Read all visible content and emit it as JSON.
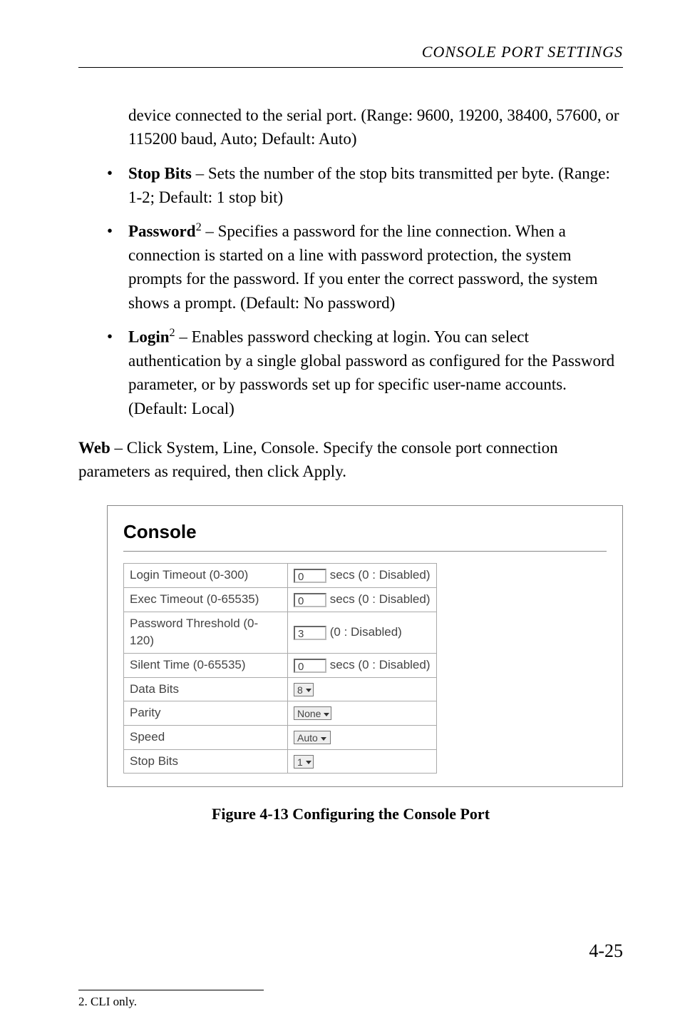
{
  "running_head": "CONSOLE PORT SETTINGS",
  "continuation_paragraph": "device connected to the serial port. (Range: 9600, 19200, 38400, 57600, or 115200 baud, Auto; Default: Auto)",
  "bullets": [
    {
      "term": "Stop Bits",
      "sup": "",
      "text": " – Sets the number of the stop bits transmitted per byte. (Range: 1-2; Default: 1 stop bit)"
    },
    {
      "term": "Password",
      "sup": "2",
      "text": " – Specifies a password for the line connection. When a connection is started on a line with password protection, the system prompts for the password. If you enter the correct password, the system shows a prompt. (Default: No password)"
    },
    {
      "term": "Login",
      "sup": "2",
      "text": " – Enables password checking at login. You can select authentication by a single global password as configured for the Password parameter, or by passwords set up for specific user-name accounts. (Default: Local)"
    }
  ],
  "web_para_lead": "Web",
  "web_para_text": " – Click System, Line, Console. Specify the console port connection parameters as required, then click Apply.",
  "figure": {
    "title": "Console",
    "rows": [
      {
        "label": "Login Timeout (0-300)",
        "value": "0",
        "suffix": "secs (0 : Disabled)",
        "type": "input"
      },
      {
        "label": "Exec Timeout (0-65535)",
        "value": "0",
        "suffix": "secs (0 : Disabled)",
        "type": "input"
      },
      {
        "label": "Password Threshold (0-120)",
        "value": "3",
        "suffix": "(0 : Disabled)",
        "type": "input"
      },
      {
        "label": "Silent Time (0-65535)",
        "value": "0",
        "suffix": "secs (0 : Disabled)",
        "type": "input"
      },
      {
        "label": "Data Bits",
        "value": "8",
        "suffix": "",
        "type": "select"
      },
      {
        "label": "Parity",
        "value": "None",
        "suffix": "",
        "type": "select"
      },
      {
        "label": "Speed",
        "value": "Auto",
        "suffix": "",
        "type": "select"
      },
      {
        "label": "Stop Bits",
        "value": "1",
        "suffix": "",
        "type": "select"
      }
    ]
  },
  "caption": "Figure 4-13  Configuring the Console Port",
  "footnote": "2.  CLI only.",
  "page_number": "4-25"
}
